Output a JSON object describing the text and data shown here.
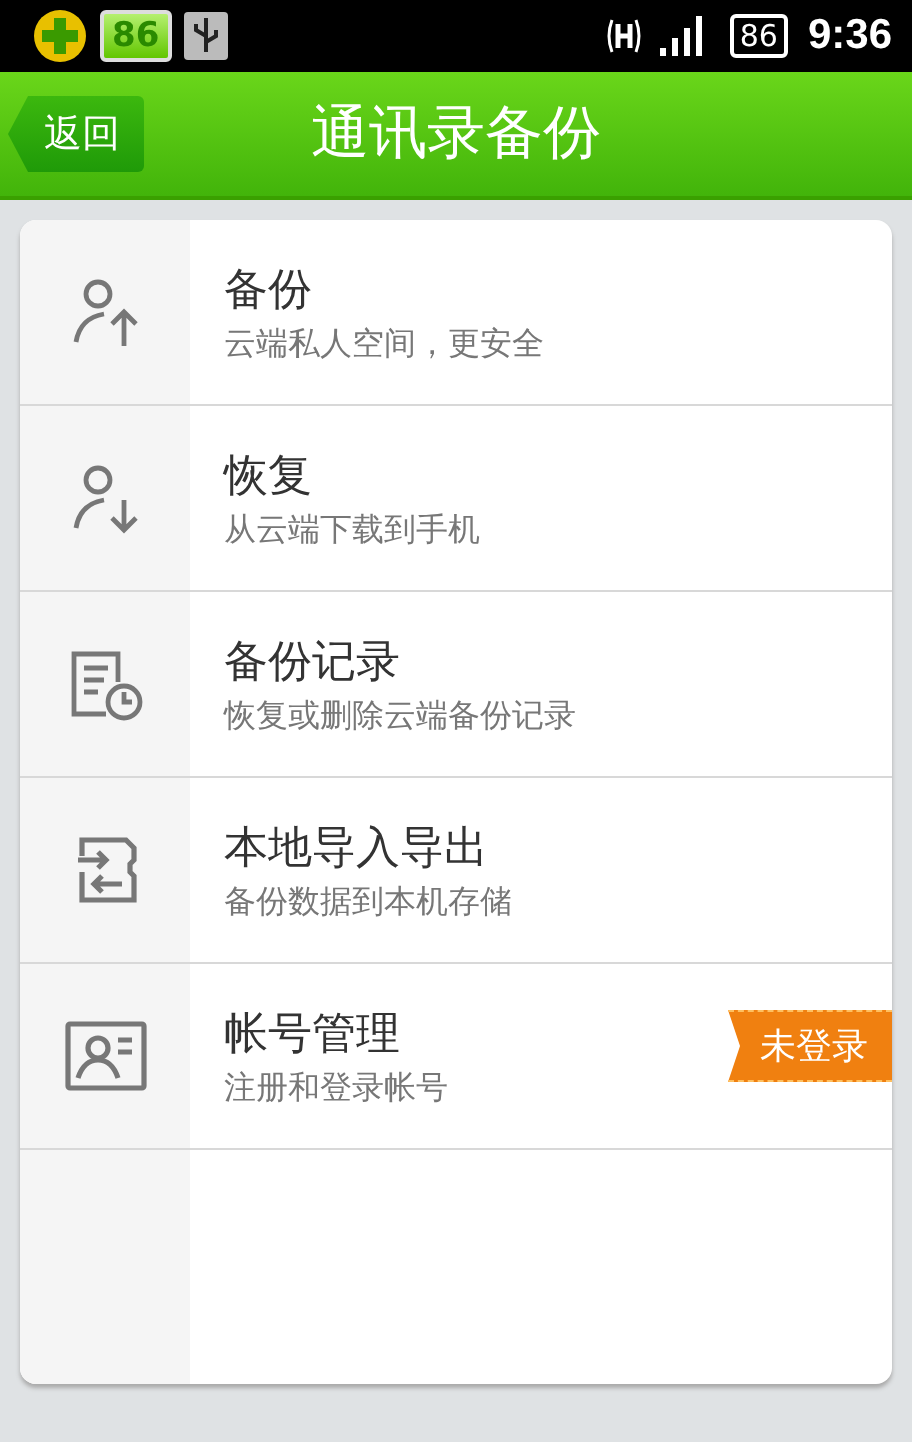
{
  "status_bar": {
    "battery_badge": "86",
    "battery": "86",
    "time": "9:36"
  },
  "header": {
    "back": "返回",
    "title": "通讯录备份"
  },
  "items": [
    {
      "kind": "upload",
      "title": "备份",
      "subtitle": "云端私人空间，更安全"
    },
    {
      "kind": "download",
      "title": "恢复",
      "subtitle": "从云端下载到手机"
    },
    {
      "kind": "history",
      "title": "备份记录",
      "subtitle": "恢复或删除云端备份记录"
    },
    {
      "kind": "transfer",
      "title": "本地导入导出",
      "subtitle": "备份数据到本机存储"
    },
    {
      "kind": "account",
      "title": "帐号管理",
      "subtitle": "注册和登录帐号",
      "badge": "未登录"
    }
  ]
}
